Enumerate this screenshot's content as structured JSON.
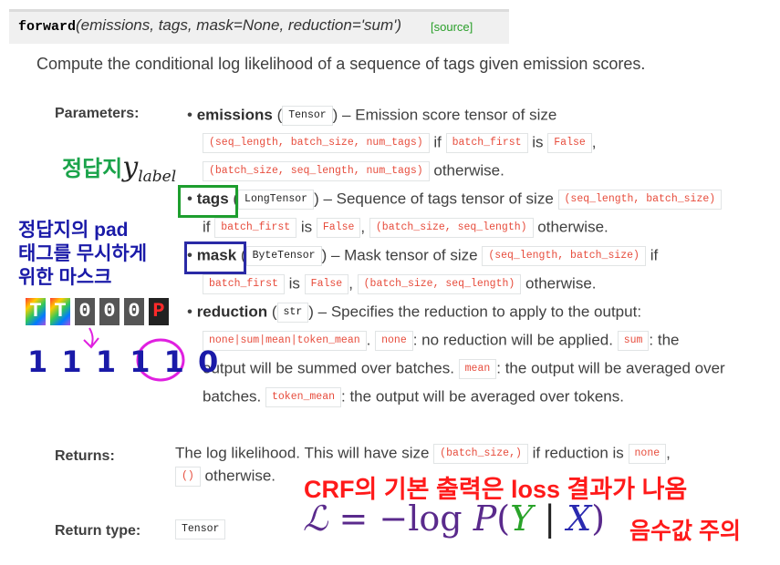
{
  "signature": {
    "function_name": "forward",
    "args": "(emissions, tags, mask=None, reduction='sum')",
    "source_link": "[source]"
  },
  "description": "Compute the conditional log likelihood of a sequence of tags given emission scores.",
  "parameters": {
    "label": "Parameters:",
    "emissions": {
      "name": "emissions",
      "type": "Tensor",
      "text1": "– Emission score tensor of size",
      "code_shape1": "(seq_length, batch_size, num_tags)",
      "if_word": "if",
      "code_cond": "batch_first",
      "is_word": "is",
      "code_false": "False",
      "comma": ",",
      "code_shape2": "(batch_size, seq_length, num_tags)",
      "otherwise": "otherwise."
    },
    "tags": {
      "name": "tags",
      "type": "LongTensor",
      "text1": "– Sequence of tags tensor of size",
      "code_shape1": "(seq_length, batch_size)",
      "if_word": "if",
      "code_cond": "batch_first",
      "is_word": "is",
      "code_false": "False",
      "comma": ",",
      "code_shape2": "(batch_size, seq_length)",
      "otherwise": "otherwise."
    },
    "mask": {
      "name": "mask",
      "type": "ByteTensor",
      "text1": "– Mask tensor of size",
      "code_shape1": "(seq_length, batch_size)",
      "if_word": "if",
      "code_cond": "batch_first",
      "is_word": "is",
      "code_false": "False",
      "comma": ",",
      "code_shape2": "(batch_size, seq_length)",
      "otherwise": "otherwise."
    },
    "reduction": {
      "name": "reduction",
      "type": "str",
      "text1": "– Specifies the reduction to apply to the output:",
      "code_opts": "none|sum|mean|token_mean",
      "dot": ".",
      "code_none": "none",
      "none_text": ": no reduction will be applied.",
      "code_sum": "sum",
      "sum_text1": ": the",
      "sum_text2": "output will be summed over batches.",
      "code_mean": "mean",
      "mean_text": ": the output will be averaged over",
      "batches": "batches.",
      "code_token_mean": "token_mean",
      "token_mean_text": ": the output will be averaged over tokens."
    }
  },
  "returns": {
    "label": "Returns:",
    "text1": "The log likelihood. This will have size",
    "code_shape": "(batch_size,)",
    "if_text": "if reduction is",
    "code_none": "none",
    "comma": ",",
    "code_empty": "()",
    "otherwise": "otherwise."
  },
  "return_type": {
    "label": "Return type:",
    "type": "Tensor"
  },
  "annotations": {
    "answer_sheet": "정답지",
    "answer_sheet_symbol_main": "y",
    "answer_sheet_symbol_sub": "label",
    "pad_mask_line1": "정답지의 pad",
    "pad_mask_line2": "태그를 무시하게",
    "pad_mask_line3": "위한 마스크",
    "tokens": [
      "T",
      "T",
      "0",
      "0",
      "0",
      "P"
    ],
    "mask_values": [
      "1",
      "1",
      "1",
      "1",
      "1",
      "0"
    ],
    "crf_output": "CRF의 기본 출력은 loss 결과가 나옴",
    "formula_L": "ℒ",
    "formula_eq": "=",
    "formula_minus": "−",
    "formula_log": "log",
    "formula_P": "P",
    "formula_lparen": "(",
    "formula_Y": "Y",
    "formula_bar": "|",
    "formula_X": "X",
    "formula_rparen": ")",
    "negative_note": "음수값 주의",
    "colors": {
      "green": "#1aa34a",
      "blue": "#1a1aa8",
      "red": "#ff1a1a",
      "magenta": "#e020e0",
      "purple": "#5a2a8c",
      "code_red": "#e74c3c",
      "source_green": "#2a9f2a"
    }
  }
}
